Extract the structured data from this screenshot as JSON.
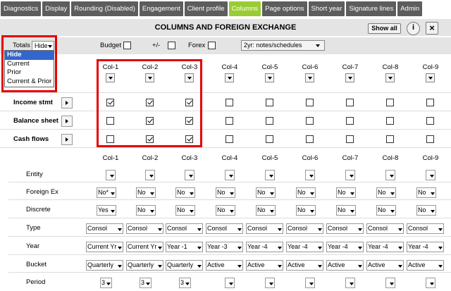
{
  "tabs": [
    {
      "label": "Diagnostics",
      "active": false
    },
    {
      "label": "Display",
      "active": false
    },
    {
      "label": "Rounding (Disabled)",
      "active": false
    },
    {
      "label": "Engagement",
      "active": false
    },
    {
      "label": "Client profile",
      "active": false
    },
    {
      "label": "Columns",
      "active": true
    },
    {
      "label": "Page options",
      "active": false
    },
    {
      "label": "Short year",
      "active": false
    },
    {
      "label": "Signature lines",
      "active": false
    },
    {
      "label": "Admin",
      "active": false
    }
  ],
  "title": "COLUMNS AND FOREIGN EXCHANGE",
  "show_all_label": "Show all",
  "info_icon": "i",
  "close_icon": "×",
  "options": {
    "totals_label": "Totals",
    "totals_value": "Hide",
    "budget_label": "Budget",
    "budget_checked": false,
    "plusminus_label": "+/-",
    "plusminus_checked": false,
    "forex_label": "Forex",
    "forex_checked": false,
    "notes_value": "2yr: notes/schedules"
  },
  "totals_dropdown": [
    "Hide",
    "Current",
    "Prior",
    "Current & Prior"
  ],
  "columns": [
    "Col-1",
    "Col-2",
    "Col-3",
    "Col-4",
    "Col-5",
    "Col-6",
    "Col-7",
    "Col-8",
    "Col-9"
  ],
  "statements": [
    {
      "label": "Income stmt",
      "checks": [
        true,
        true,
        true,
        false,
        false,
        false,
        false,
        false,
        false
      ]
    },
    {
      "label": "Balance sheet",
      "checks": [
        false,
        true,
        true,
        false,
        false,
        false,
        false,
        false,
        false
      ]
    },
    {
      "label": "Cash flows",
      "checks": [
        false,
        true,
        true,
        false,
        false,
        false,
        false,
        false,
        false
      ]
    }
  ],
  "grid_rows": [
    {
      "label": "Entity",
      "values": [
        "",
        "",
        "",
        "",
        "",
        "",
        "",
        "",
        ""
      ]
    },
    {
      "label": "Foreign Ex",
      "values": [
        "No*",
        "No",
        "No",
        "No",
        "No",
        "No",
        "No",
        "No",
        "No"
      ]
    },
    {
      "label": "Discrete",
      "values": [
        "Yes",
        "No",
        "No",
        "No",
        "No",
        "No",
        "No",
        "No",
        "No"
      ]
    },
    {
      "label": "Type",
      "values": [
        "Consol",
        "Consol",
        "Consol",
        "Consol",
        "Consol",
        "Consol",
        "Consol",
        "Consol",
        "Consol"
      ]
    },
    {
      "label": "Year",
      "values": [
        "Current Yr",
        "Current Yr",
        "Year -1",
        "Year -3",
        "Year -4",
        "Year -4",
        "Year -4",
        "Year -4",
        "Year -4"
      ]
    },
    {
      "label": "Bucket",
      "values": [
        "Quarterly",
        "Quarterly",
        "Quarterly",
        "Active",
        "Active",
        "Active",
        "Active",
        "Active",
        "Active"
      ]
    },
    {
      "label": "Period",
      "values": [
        "3",
        "3",
        "3",
        "",
        "",
        "",
        "",
        "",
        ""
      ]
    }
  ],
  "colors": {
    "tab": "#5d5d5d",
    "tab_active": "#99cc33",
    "bar": "#e4e4e4",
    "highlight": "#e60000",
    "selection": "#3366cc"
  }
}
